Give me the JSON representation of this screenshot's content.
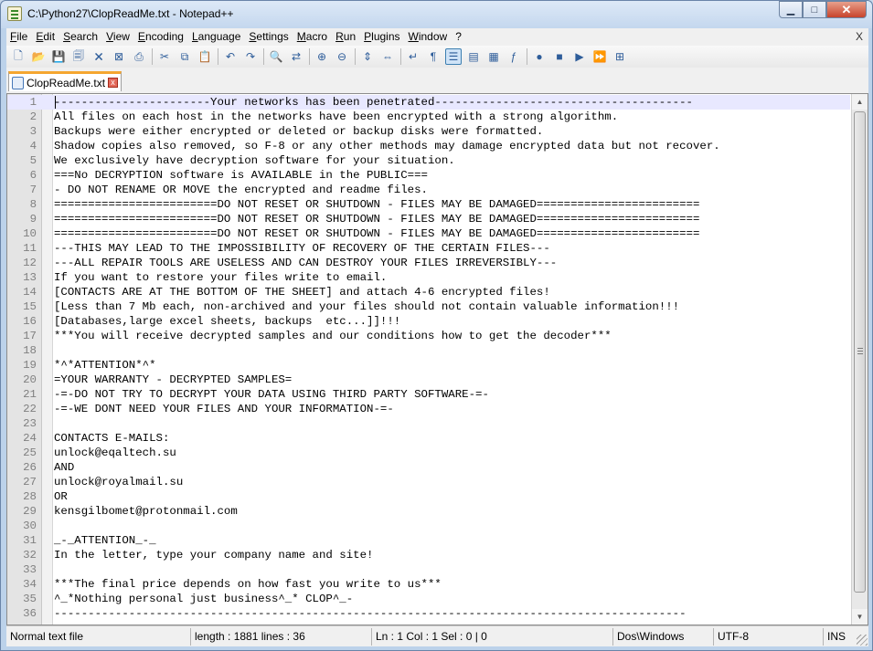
{
  "window": {
    "title": "C:\\Python27\\ClopReadMe.txt - Notepad++",
    "minimize": "▁",
    "maximize": "□",
    "close": "✕"
  },
  "menu": {
    "items": [
      "File",
      "Edit",
      "Search",
      "View",
      "Encoding",
      "Language",
      "Settings",
      "Macro",
      "Run",
      "Plugins",
      "Window",
      "?"
    ],
    "close": "X"
  },
  "toolbar": {
    "icons": [
      {
        "name": "new-file-icon",
        "glyph": "🗋"
      },
      {
        "name": "open-file-icon",
        "glyph": "📂"
      },
      {
        "name": "save-icon",
        "glyph": "💾"
      },
      {
        "name": "save-all-icon",
        "glyph": "🗐"
      },
      {
        "name": "close-file-icon",
        "glyph": "🗙"
      },
      {
        "name": "close-all-icon",
        "glyph": "⊠"
      },
      {
        "name": "print-icon",
        "glyph": "⎙"
      },
      {
        "sep": true
      },
      {
        "name": "cut-icon",
        "glyph": "✂"
      },
      {
        "name": "copy-icon",
        "glyph": "⧉"
      },
      {
        "name": "paste-icon",
        "glyph": "📋"
      },
      {
        "sep": true
      },
      {
        "name": "undo-icon",
        "glyph": "↶"
      },
      {
        "name": "redo-icon",
        "glyph": "↷"
      },
      {
        "sep": true
      },
      {
        "name": "find-icon",
        "glyph": "🔍"
      },
      {
        "name": "replace-icon",
        "glyph": "⇄"
      },
      {
        "sep": true
      },
      {
        "name": "zoom-in-icon",
        "glyph": "⊕"
      },
      {
        "name": "zoom-out-icon",
        "glyph": "⊖"
      },
      {
        "sep": true
      },
      {
        "name": "sync-vertical-icon",
        "glyph": "⇕"
      },
      {
        "name": "sync-horizontal-icon",
        "glyph": "⇔"
      },
      {
        "sep": true
      },
      {
        "name": "word-wrap-icon",
        "glyph": "↵"
      },
      {
        "name": "show-all-chars-icon",
        "glyph": "¶"
      },
      {
        "name": "indent-guide-icon",
        "glyph": "☰",
        "active": true
      },
      {
        "name": "user-language-icon",
        "glyph": "▤"
      },
      {
        "name": "doc-map-icon",
        "glyph": "▦"
      },
      {
        "name": "function-list-icon",
        "glyph": "ƒ"
      },
      {
        "sep": true
      },
      {
        "name": "macro-record-icon",
        "glyph": "●"
      },
      {
        "name": "macro-stop-icon",
        "glyph": "■"
      },
      {
        "name": "macro-play-icon",
        "glyph": "▶"
      },
      {
        "name": "macro-run-multiple-icon",
        "glyph": "⏩"
      },
      {
        "name": "macro-save-icon",
        "glyph": "⊞"
      }
    ]
  },
  "tab": {
    "label": "ClopReadMe.txt",
    "close": "x"
  },
  "editor": {
    "lines": [
      "-----------------------Your networks has been penetrated--------------------------------------",
      "All files on each host in the networks have been encrypted with a strong algorithm.",
      "Backups were either encrypted or deleted or backup disks were formatted.",
      "Shadow copies also removed, so F-8 or any other methods may damage encrypted data but not recover.",
      "We exclusively have decryption software for your situation.",
      "===No DECRYPTION software is AVAILABLE in the PUBLIC===",
      "- DO NOT RENAME OR MOVE the encrypted and readme files.",
      "========================DO NOT RESET OR SHUTDOWN - FILES MAY BE DAMAGED========================",
      "========================DO NOT RESET OR SHUTDOWN - FILES MAY BE DAMAGED========================",
      "========================DO NOT RESET OR SHUTDOWN - FILES MAY BE DAMAGED========================",
      "---THIS MAY LEAD TO THE IMPOSSIBILITY OF RECOVERY OF THE CERTAIN FILES---",
      "---ALL REPAIR TOOLS ARE USELESS AND CAN DESTROY YOUR FILES IRREVERSIBLY---",
      "If you want to restore your files write to email.",
      "[CONTACTS ARE AT THE BOTTOM OF THE SHEET] and attach 4-6 encrypted files!",
      "[Less than 7 Mb each, non-archived and your files should not contain valuable information!!!",
      "[Databases,large excel sheets, backups  etc...]]!!!",
      "***You will receive decrypted samples and our conditions how to get the decoder***",
      "",
      "*^*ATTENTION*^*",
      "=YOUR WARRANTY - DECRYPTED SAMPLES=",
      "-=-DO NOT TRY TO DECRYPT YOUR DATA USING THIRD PARTY SOFTWARE-=-",
      "-=-WE DONT NEED YOUR FILES AND YOUR INFORMATION-=-",
      "",
      "CONTACTS E-MAILS:",
      "unlock@eqaltech.su",
      "AND",
      "unlock@royalmail.su",
      "OR",
      "kensgilbomet@protonmail.com",
      "",
      "_-_ATTENTION_-_",
      "In the letter, type your company name and site!",
      "",
      "***The final price depends on how fast you write to us***",
      "^_*Nothing personal just business^_* CLOP^_-",
      "---------------------------------------------------------------------------------------------"
    ]
  },
  "status": {
    "type": "Normal text file",
    "length_lines": "length : 1881    lines : 36",
    "position": "Ln : 1    Col : 1    Sel : 0 | 0",
    "eol": "Dos\\Windows",
    "encoding": "UTF-8",
    "mode": "INS"
  }
}
